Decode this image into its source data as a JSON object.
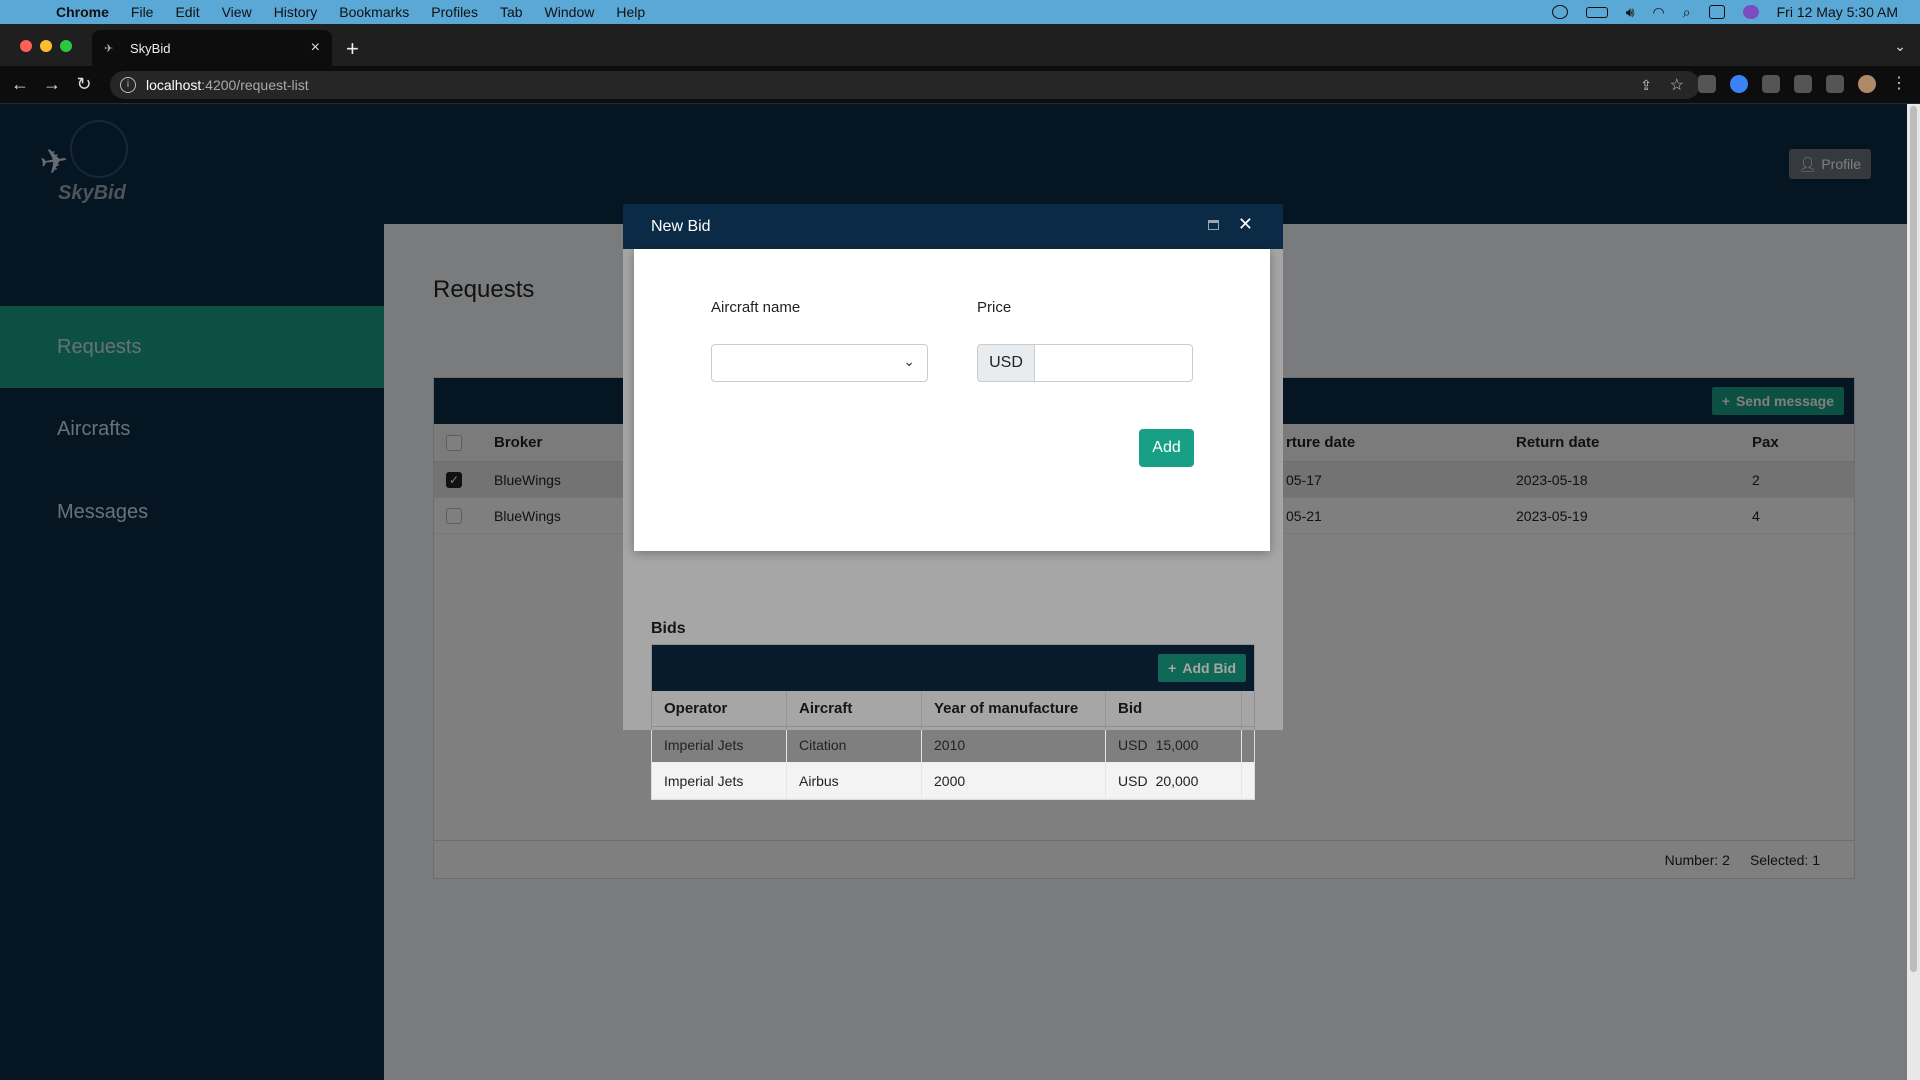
{
  "menubar": {
    "app": "Chrome",
    "items": [
      "File",
      "Edit",
      "View",
      "History",
      "Bookmarks",
      "Profiles",
      "Tab",
      "Window",
      "Help"
    ],
    "clock": "Fri 12 May  5:30 AM"
  },
  "browser": {
    "tab_title": "SkyBid",
    "url_host": "localhost",
    "url_path": ":4200/request-list"
  },
  "app": {
    "logo_text": "SkyBid",
    "profile_label": "Profile",
    "sidebar": [
      {
        "label": "Requests",
        "active": true
      },
      {
        "label": "Aircrafts",
        "active": false
      },
      {
        "label": "Messages",
        "active": false
      }
    ],
    "page_title": "Requests",
    "requests_grid": {
      "send_message_label": "Send message",
      "columns": [
        "Broker",
        "rture date",
        "Return date",
        "Pax"
      ],
      "rows": [
        {
          "broker": "BlueWings",
          "departure": "05-17",
          "return": "2023-05-18",
          "pax": "2",
          "selected": true
        },
        {
          "broker": "BlueWings",
          "departure": "05-21",
          "return": "2023-05-19",
          "pax": "4",
          "selected": false
        }
      ],
      "footer_number": "Number: 2",
      "footer_selected": "Selected: 1"
    }
  },
  "bids_dialog": {
    "title": "Bids",
    "add_bid_label": "Add Bid",
    "columns": [
      "Operator",
      "Aircraft",
      "Year of manufacture",
      "Bid"
    ],
    "rows": [
      {
        "operator": "Imperial Jets",
        "aircraft": "Citation",
        "year": "2010",
        "currency": "USD",
        "amount": "15,000"
      },
      {
        "operator": "Imperial Jets",
        "aircraft": "Airbus",
        "year": "2000",
        "currency": "USD",
        "amount": "20,000"
      }
    ]
  },
  "new_bid_dialog": {
    "title": "New Bid",
    "aircraft_label": "Aircraft name",
    "aircraft_value": "",
    "price_label": "Price",
    "price_currency": "USD",
    "price_value": "",
    "add_label": "Add"
  },
  "colors": {
    "navy": "#0b2a45",
    "teal": "#17a085"
  }
}
